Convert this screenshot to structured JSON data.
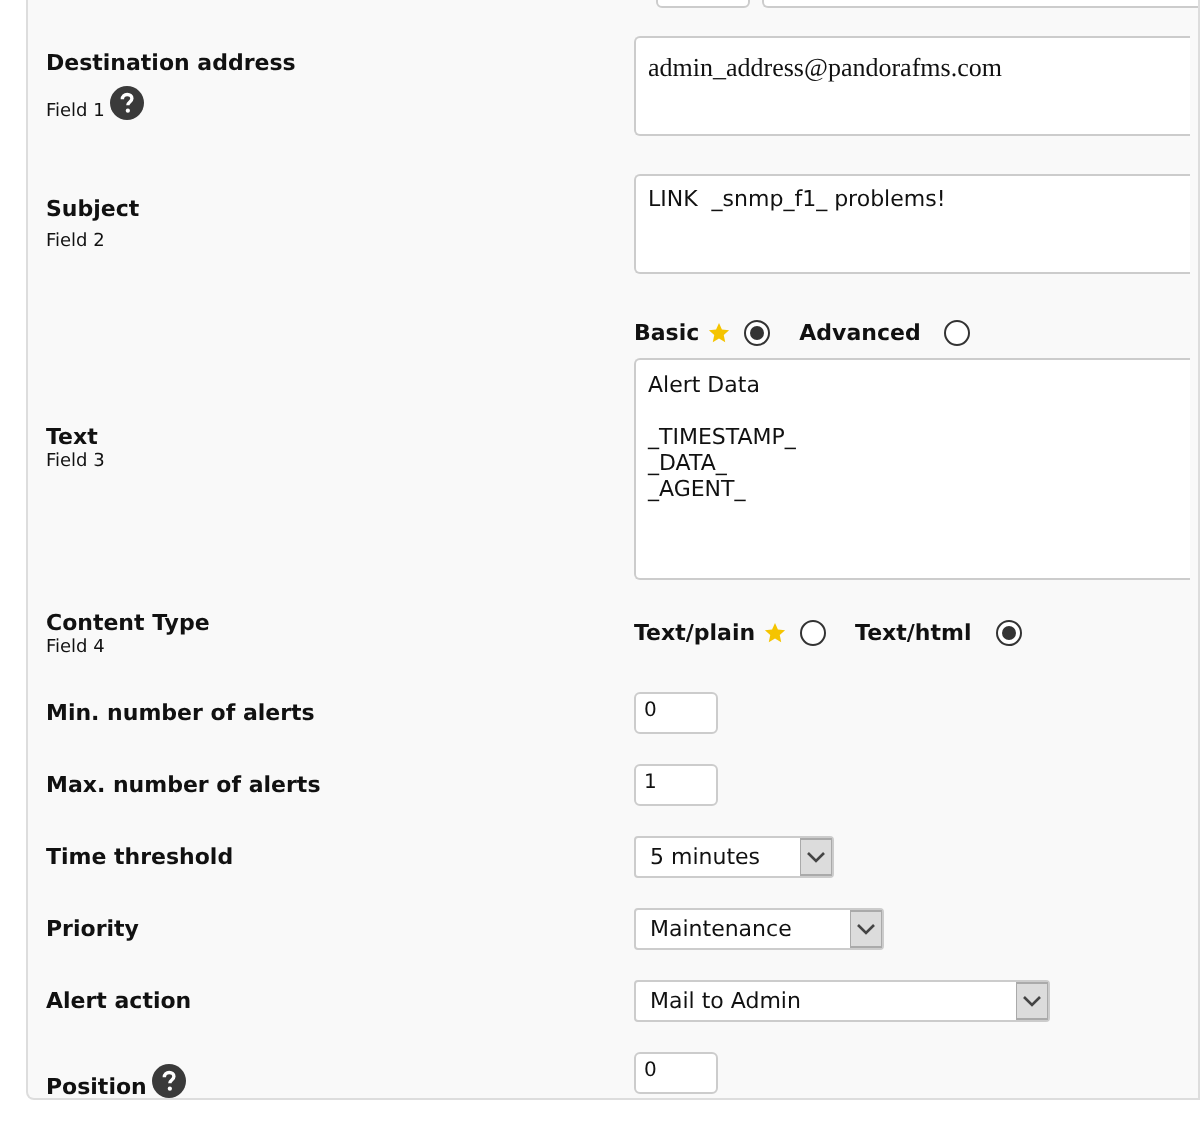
{
  "fields": [
    {
      "kind": "textarea",
      "label": "Destination address",
      "sublabel": "Field 1",
      "help": true,
      "value": "admin_address@pandorafms.com",
      "serif": true
    },
    {
      "kind": "textarea",
      "label": "Subject",
      "sublabel": "Field 2",
      "help": false,
      "value": "LINK  _snmp_f1_ problems!",
      "serif": false
    },
    {
      "kind": "editor",
      "label": "Text",
      "sublabel": "Field 3",
      "help": false,
      "modes": [
        {
          "label": "Basic",
          "starred": true,
          "selected": true
        },
        {
          "label": "Advanced",
          "starred": false,
          "selected": false
        }
      ],
      "value": "Alert Data\n\n_TIMESTAMP_\n_DATA_\n_AGENT_"
    },
    {
      "kind": "radio",
      "label": "Content Type",
      "sublabel": "Field 4",
      "help": false,
      "options": [
        {
          "label": "Text/plain",
          "starred": true,
          "selected": false
        },
        {
          "label": "Text/html",
          "starred": false,
          "selected": true
        }
      ]
    },
    {
      "kind": "number",
      "label": "Min. number of alerts",
      "help": false,
      "value": "0"
    },
    {
      "kind": "number",
      "label": "Max. number of alerts",
      "help": false,
      "value": "1"
    },
    {
      "kind": "select",
      "label": "Time threshold",
      "help": false,
      "value": "5 minutes"
    },
    {
      "kind": "select",
      "label": "Priority",
      "help": false,
      "value": "Maintenance"
    },
    {
      "kind": "select",
      "label": "Alert action",
      "help": false,
      "value": "Mail to Admin"
    },
    {
      "kind": "number",
      "label": "Position",
      "help": true,
      "value": "0"
    }
  ]
}
